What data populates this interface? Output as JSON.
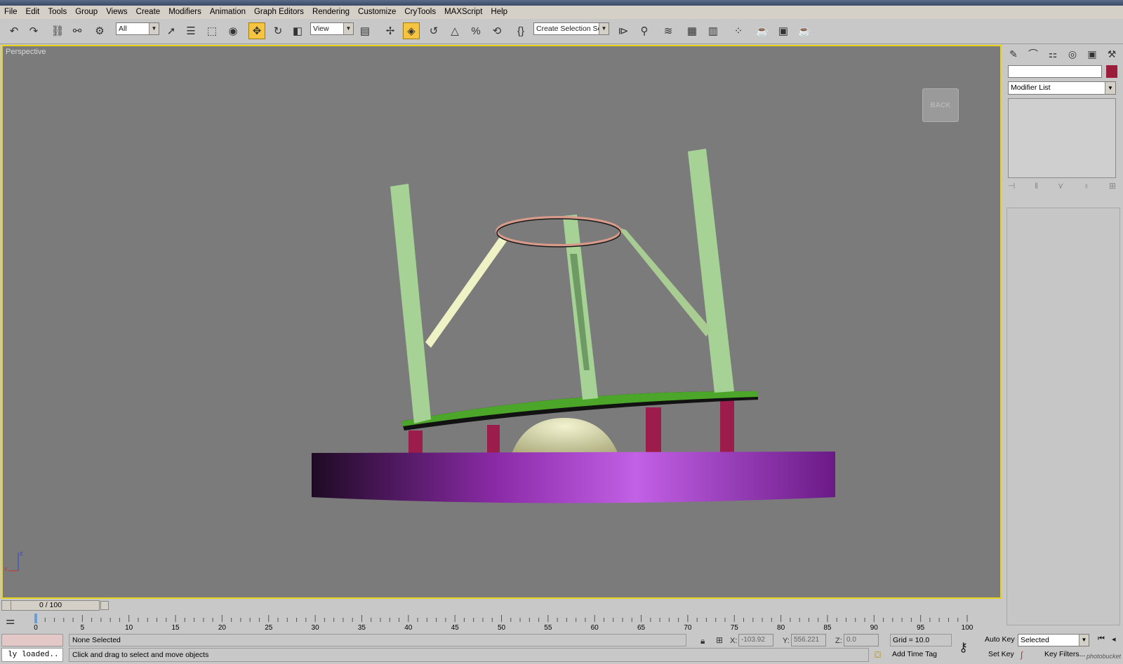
{
  "menu": [
    "File",
    "Edit",
    "Tools",
    "Group",
    "Views",
    "Create",
    "Modifiers",
    "Animation",
    "Graph Editors",
    "Rendering",
    "Customize",
    "CryTools",
    "MAXScript",
    "Help"
  ],
  "toolbar": {
    "filter_value": "All",
    "refcoord_value": "View",
    "selection_set_placeholder": "Create Selection Set"
  },
  "viewport": {
    "label": "Perspective",
    "viewcube_label": "BACK",
    "axis_z": "z",
    "axis_x": "x"
  },
  "timeline": {
    "slider_text": "0 / 100",
    "ticks": [
      "0",
      "5",
      "10",
      "15",
      "20",
      "25",
      "30",
      "35",
      "40",
      "45",
      "50",
      "55",
      "60",
      "65",
      "70",
      "75",
      "80",
      "85",
      "90",
      "95",
      "100"
    ]
  },
  "command_panel": {
    "modifier_list": "Modifier List",
    "object_color": "#9c1c3c"
  },
  "status": {
    "maxscript_text": "ly loaded..",
    "selection_text": "None Selected",
    "prompt_text": "Click and drag to select and move objects",
    "x_label": "X:",
    "x_value": "-103.92",
    "y_label": "Y:",
    "y_value": "556.221",
    "z_label": "Z:",
    "z_value": "0.0",
    "grid_text": "Grid = 10.0",
    "add_time_tag": "Add Time Tag",
    "auto_key": "Auto Key",
    "set_key": "Set Key",
    "selected_value": "Selected",
    "key_filters": "Key Filters...",
    "watermark": "photobucket"
  }
}
